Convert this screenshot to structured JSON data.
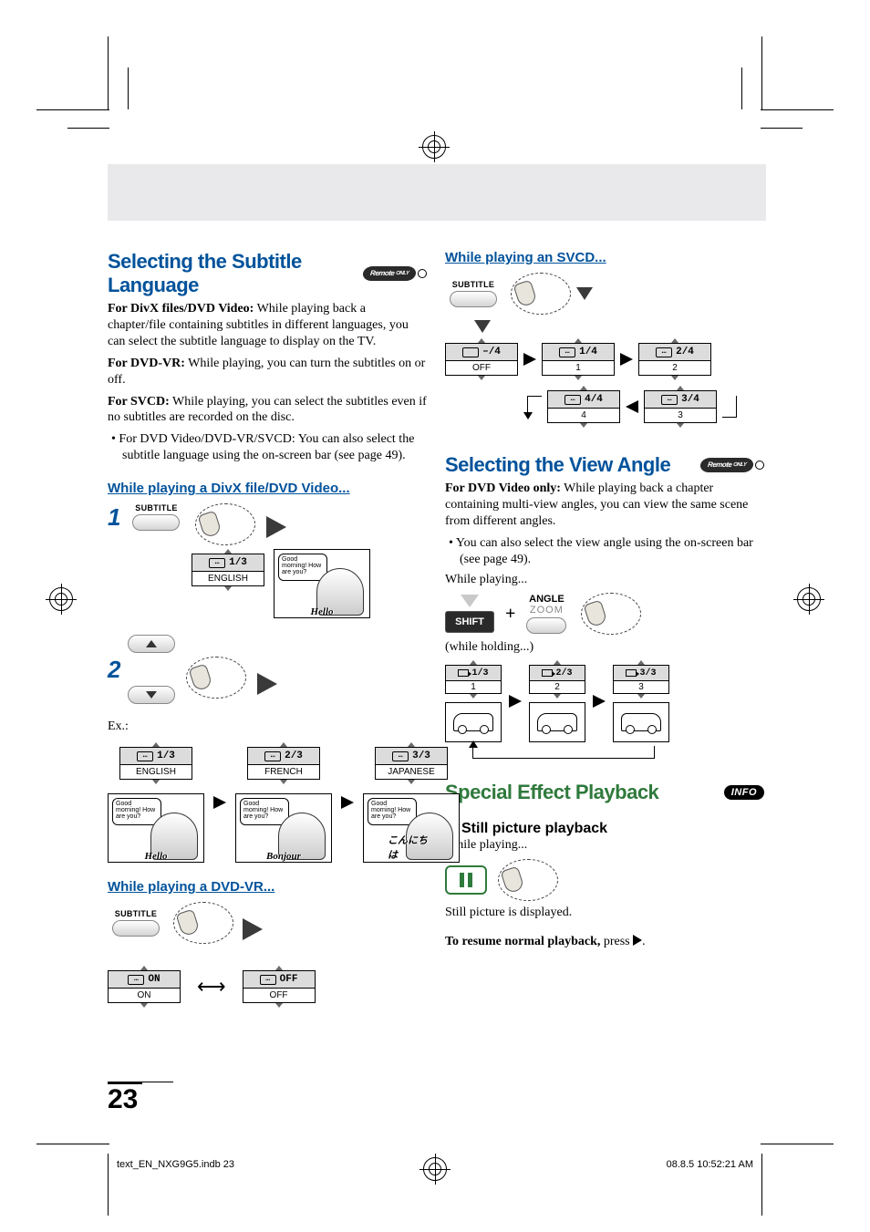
{
  "page_number": "23",
  "footer": {
    "left": "text_EN_NXG9G5.indb   23",
    "right": "08.8.5   10:52:21 AM"
  },
  "remote_badge": {
    "line1": "Remote",
    "line2": "ONLY"
  },
  "info_badge": "INFO",
  "left": {
    "title": "Selecting the Subtitle Language",
    "p1_lead": "For DivX files/DVD Video:",
    "p1_rest": " While playing back a chapter/file containing subtitles in different languages, you can select the subtitle language to display on the TV.",
    "p2_lead": "For DVD-VR:",
    "p2_rest": " While playing, you can turn the subtitles on or off.",
    "p3_lead": "For SVCD:",
    "p3_rest": " While playing, you can select the subtitles even if no subtitles are recorded on the disc.",
    "bullet1": "For DVD Video/DVD-VR/SVCD: You can also select the subtitle language using the on-screen bar (see page 49).",
    "sub1": "While playing a DivX file/DVD Video...",
    "step1": "1",
    "step2": "2",
    "subtitle_btn": "SUBTITLE",
    "osd_step1": {
      "top": "1/3",
      "bot": "ENGLISH"
    },
    "ex_label": "Ex.:",
    "ex": [
      {
        "top": "1/3",
        "bot": "ENGLISH",
        "cap": "Hello"
      },
      {
        "top": "2/3",
        "bot": "FRENCH",
        "cap": "Bonjour"
      },
      {
        "top": "3/3",
        "bot": "JAPANESE",
        "cap": "こんにちは"
      }
    ],
    "speech_sample": "Good morning! How are you?",
    "sub2": "While playing a DVD-VR...",
    "dvdvr": {
      "on_top": "ON",
      "on_bot": "ON",
      "off_top": "OFF",
      "off_bot": "OFF"
    }
  },
  "right": {
    "sub_svcd": "While playing an SVCD...",
    "svcd": {
      "r1c1_top": "–/4",
      "r1c1_bot": "OFF",
      "r1c2_top": "1/4",
      "r1c2_bot": "1",
      "r1c3_top": "2/4",
      "r1c3_bot": "2",
      "r2c1_top": "4/4",
      "r2c1_bot": "4",
      "r2c2_top": "3/4",
      "r2c2_bot": "3"
    },
    "angle_title": "Selecting the View Angle",
    "angle_p_lead": "For DVD Video only:",
    "angle_p_rest": " While playing back a chapter containing multi-view angles, you can view the same scene from different angles.",
    "angle_bullet": "You can also select the view angle using the on-screen bar (see page 49).",
    "while_playing": "While playing...",
    "shift": "SHIFT",
    "angle_btn_top": "ANGLE",
    "angle_btn_bot": "ZOOM",
    "holding_note": "(while holding...)",
    "angles": [
      {
        "top": "1/3",
        "bot": "1"
      },
      {
        "top": "2/3",
        "bot": "2"
      },
      {
        "top": "3/3",
        "bot": "3"
      }
    ],
    "special_title": "Special Effect Playback",
    "still_head": "Still picture playback",
    "still_line": "While playing...",
    "still_result": "Still picture is displayed.",
    "resume_lead": "To resume normal playback,",
    "resume_rest": " press "
  }
}
